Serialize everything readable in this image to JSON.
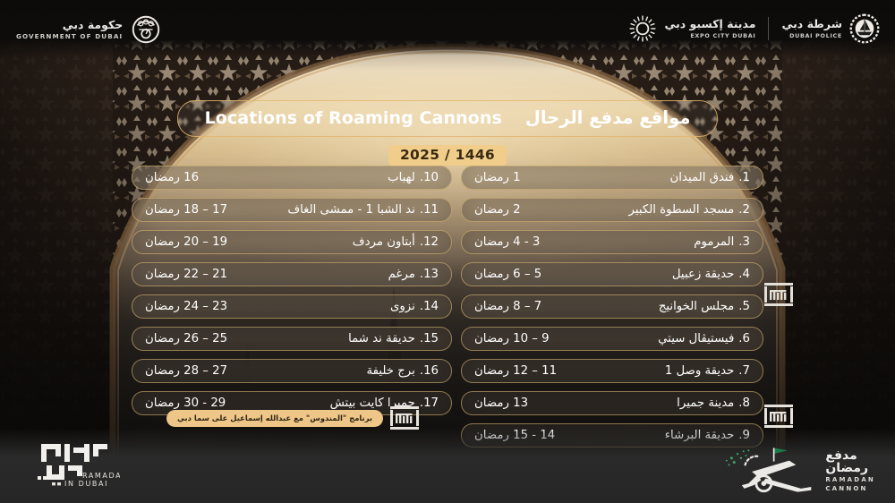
{
  "header": {
    "left_logos": [
      {
        "name": "government-of-dubai",
        "ar": "حكومة دبي",
        "en": "GOVERNMENT OF DUBAI"
      }
    ],
    "right_logos": [
      {
        "name": "expo-city-dubai",
        "ar": "مدينة إكسبو دبي",
        "en": "EXPO CITY DUBAI"
      },
      {
        "name": "dubai-police",
        "ar": "شرطة دبي",
        "en": "DUBAI POLICE"
      }
    ]
  },
  "title": {
    "english": "Locations of Roaming Cannons",
    "arabic": "مواقع مدفع الرحال",
    "year": "2025 / 1446"
  },
  "ramadan_label": "رمضان",
  "columns": {
    "right": [
      {
        "num": "1.",
        "name": "فندق الميدان",
        "date": "1 رمضان"
      },
      {
        "num": "2.",
        "name": "مسجد السطوة الكبير",
        "date": "2 رمضان"
      },
      {
        "num": "3.",
        "name": "المرموم",
        "date": "3 - 4 رمضان"
      },
      {
        "num": "4.",
        "name": "حديقة زعبيل",
        "date": "5 – 6 رمضان"
      },
      {
        "num": "5.",
        "name": "مجلس الخوانيج",
        "date": "7 – 8 رمضان"
      },
      {
        "num": "6.",
        "name": "فيستيڤال سيتي",
        "date": "9 – 10 رمضان"
      },
      {
        "num": "7.",
        "name": "حديقة وصل 1",
        "date": "11 – 12 رمضان"
      },
      {
        "num": "8.",
        "name": "مدينة جميرا",
        "date": "13 رمضان"
      },
      {
        "num": "9.",
        "name": "حديقة البرشاء",
        "date": "14 - 15 رمضان"
      }
    ],
    "left": [
      {
        "num": "10.",
        "name": "لهباب",
        "date": "16 رمضان"
      },
      {
        "num": "11.",
        "name": "ند الشبا 1 -  ممشى الغاف",
        "date": "17 – 18 رمضان"
      },
      {
        "num": "12.",
        "name": "أبتاون مردف",
        "date": "19 – 20 رمضان"
      },
      {
        "num": "13.",
        "name": "مرغم",
        "date": "21 – 22 رمضان"
      },
      {
        "num": "14.",
        "name": "نزوى",
        "date": "23 – 24 رمضان"
      },
      {
        "num": "15.",
        "name": "حديقة ند شما",
        "date": "25 – 26 رمضان"
      },
      {
        "num": "16.",
        "name": "برج خليفة",
        "date": "27 – 28 رمضان"
      },
      {
        "num": "17.",
        "name": "جميرا كايت بيتش",
        "date": "29 - 30 رمضان"
      }
    ]
  },
  "programme": {
    "text": "برنامج \"المندوس\" مع عبدالله إسماعيل على سما دبي",
    "logo_text": "المندوس"
  },
  "footer": {
    "ramadan_in_dubai": {
      "ar": "رمضان في دبي",
      "en": "RAMADAN IN DUBAI"
    },
    "ramadan_cannon": {
      "ar_line1": "مدفع",
      "ar_line2": "رمضان",
      "en_line1": "RAMADAN",
      "en_line2": "CANNON"
    }
  },
  "colors": {
    "gold_border": "#cfac6e",
    "year_badge": "#f0cd8a",
    "programme_badge": "#eec687",
    "flag_green": "#1e7a4a"
  }
}
